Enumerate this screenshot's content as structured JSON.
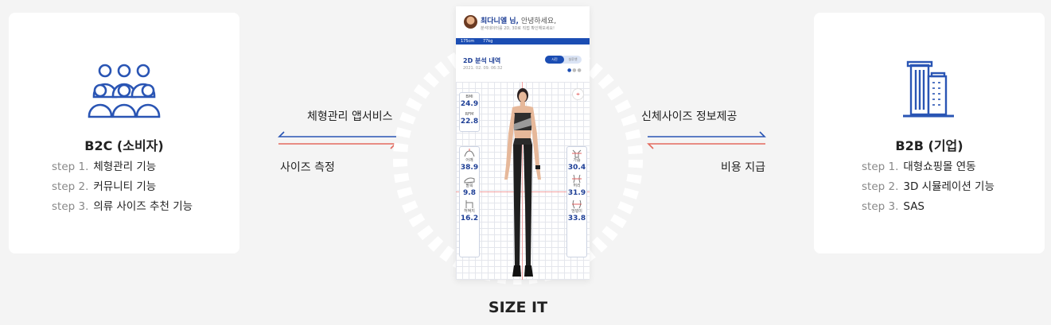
{
  "b2c": {
    "title": "B2C (소비자)",
    "steps": [
      {
        "step": "step 1.",
        "text": "체형관리 기능"
      },
      {
        "step": "step 2.",
        "text": "커뮤니티 기능"
      },
      {
        "step": "step 3.",
        "text": "의류 사이즈 추천 기능"
      }
    ]
  },
  "b2b": {
    "title": "B2B (기업)",
    "steps": [
      {
        "step": "step 1.",
        "text": "대형쇼핑몰 연동"
      },
      {
        "step": "step 2.",
        "text": "3D 시뮬레이션 기능"
      },
      {
        "step": "step 3.",
        "text": "SAS"
      }
    ]
  },
  "flows": {
    "left_top": "체형관리 앱서비스",
    "left_bottom": "사이즈 측정",
    "right_top": "신체사이즈 정보제공",
    "right_bottom": "비용 지급"
  },
  "colors": {
    "arrow_blue": "#2a55b4",
    "arrow_red": "#e36a5e",
    "brand": "#1b4db3"
  },
  "phone": {
    "user_name": "최다니엘 님,",
    "greeting": " 안녕하세요,",
    "subtext": "분석데이터를 2D, 3D로 직접 확인해보세요!",
    "height": "175cm",
    "weight": "77kg",
    "section_title": "2D 분석 내역",
    "section_date": "2021. 02. 09. 06:32",
    "toggle_on": "사진",
    "toggle_off": "실루엣",
    "metrics_top": [
      {
        "label": "BMI",
        "value": "24.9"
      },
      {
        "label": "RFM",
        "value": "22.8"
      }
    ],
    "metrics_left": [
      {
        "label": "어깨",
        "value": "38.9",
        "icon": "shoulder-icon"
      },
      {
        "label": "팔목",
        "value": "9.8",
        "icon": "wrist-icon"
      },
      {
        "label": "허벅지",
        "value": "16.2",
        "icon": "thigh-icon"
      }
    ],
    "metrics_right": [
      {
        "label": "가슴",
        "value": "30.4",
        "icon": "chest-icon"
      },
      {
        "label": "허리",
        "value": "31.9",
        "icon": "waist-icon"
      },
      {
        "label": "엉덩이",
        "value": "33.8",
        "icon": "hip-icon"
      }
    ]
  },
  "caption": "SIZE IT"
}
